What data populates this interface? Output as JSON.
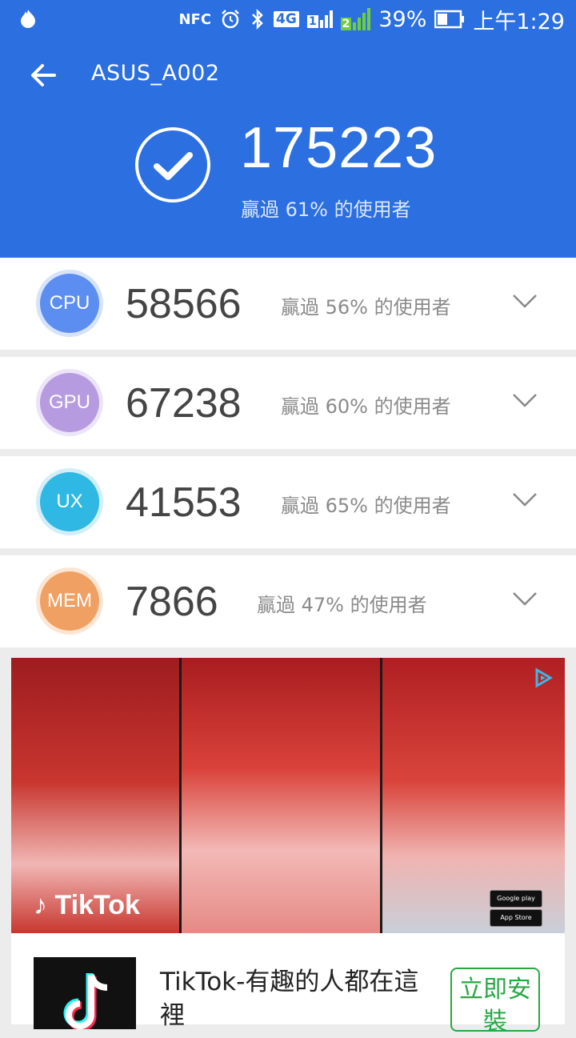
{
  "status_bar": {
    "nfc": "NFC",
    "network": "4G",
    "sim1": "1",
    "sim2": "2",
    "battery": "39%",
    "time": "上午1:29"
  },
  "header": {
    "device_name": "ASUS_A002",
    "total_score": "175223",
    "total_beat": "贏過 61% 的使用者"
  },
  "scores": [
    {
      "label": "CPU",
      "value": "58566",
      "beat": "贏過 56% 的使用者",
      "color": "#5b8ef0"
    },
    {
      "label": "GPU",
      "value": "67238",
      "beat": "贏過 60% 的使用者",
      "color": "#b79be0"
    },
    {
      "label": "UX",
      "value": "41553",
      "beat": "贏過 65% 的使用者",
      "color": "#2eb8e3"
    },
    {
      "label": "MEM",
      "value": "7866",
      "beat": "贏過 47% 的使用者",
      "color": "#f0a062"
    }
  ],
  "ad": {
    "brand_logo": "TikTok",
    "google_play": "Google play",
    "app_store": "App Store",
    "title": "TikTok-有趣的人都在這裡",
    "install_label": "立即安裝"
  },
  "colors": {
    "header_bg": "#2b6fe0",
    "install_green": "#28a745"
  }
}
